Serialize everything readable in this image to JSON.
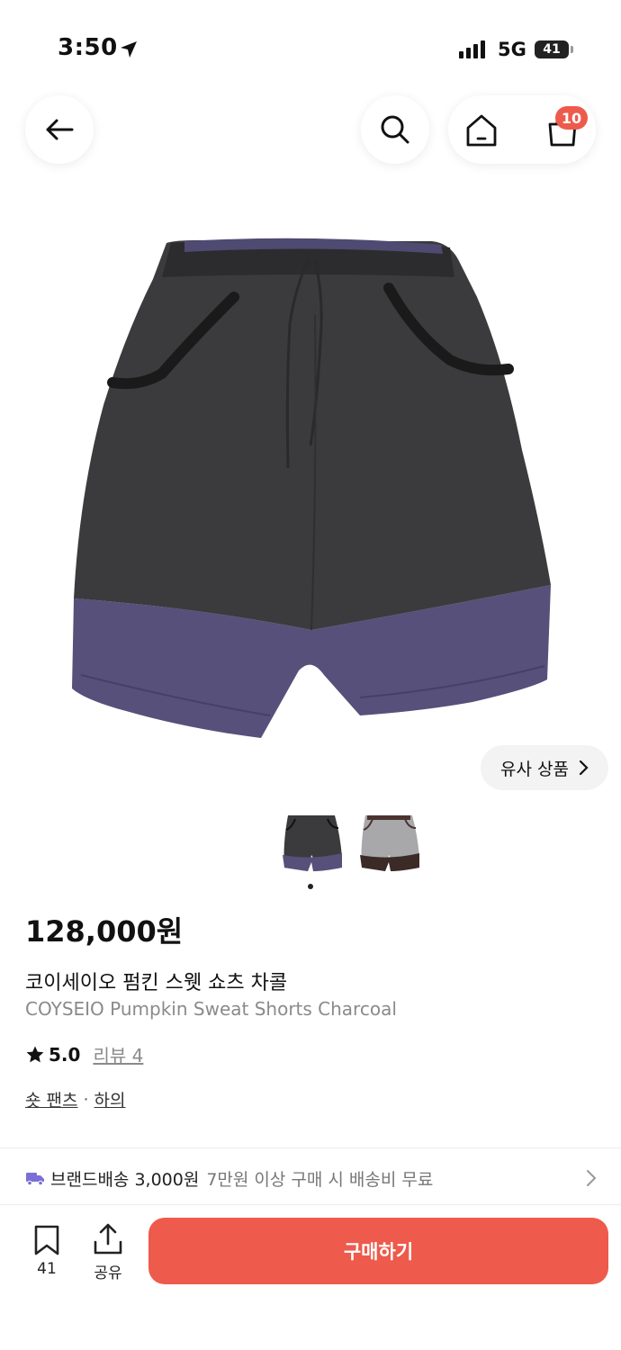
{
  "status_bar": {
    "time": "3:50",
    "network": "5G",
    "battery": "41"
  },
  "header": {
    "back_icon": "arrow-left-icon",
    "search_icon": "search-icon",
    "home_icon": "home-icon",
    "cart_icon": "bag-icon",
    "cart_badge": "10"
  },
  "gallery": {
    "similar_label": "유사 상품",
    "thumbnail_count": 2,
    "active_index": 0
  },
  "product": {
    "price": "128,000원",
    "name_ko": "코이세이오 펌킨 스웻 쇼츠 차콜",
    "name_en": "COYSEIO Pumpkin Sweat Shorts Charcoal",
    "rating": "5.0",
    "review_label": "리뷰 4",
    "category_1": "숏 팬츠",
    "separator": "·",
    "category_2": "하의"
  },
  "shipping": {
    "title": "브랜드배송 3,000원",
    "note": "7만원 이상 구매 시 배송비 무료"
  },
  "bottom_bar": {
    "bookmark_count": "41",
    "share_label": "공유",
    "buy_label": "구매하기"
  },
  "colors": {
    "accent": "#ee5a4b",
    "badge": "#ee5a4b",
    "truck": "#7b6fd6",
    "shorts_body": "#3b3b3e",
    "shorts_hem": "#56507a"
  }
}
